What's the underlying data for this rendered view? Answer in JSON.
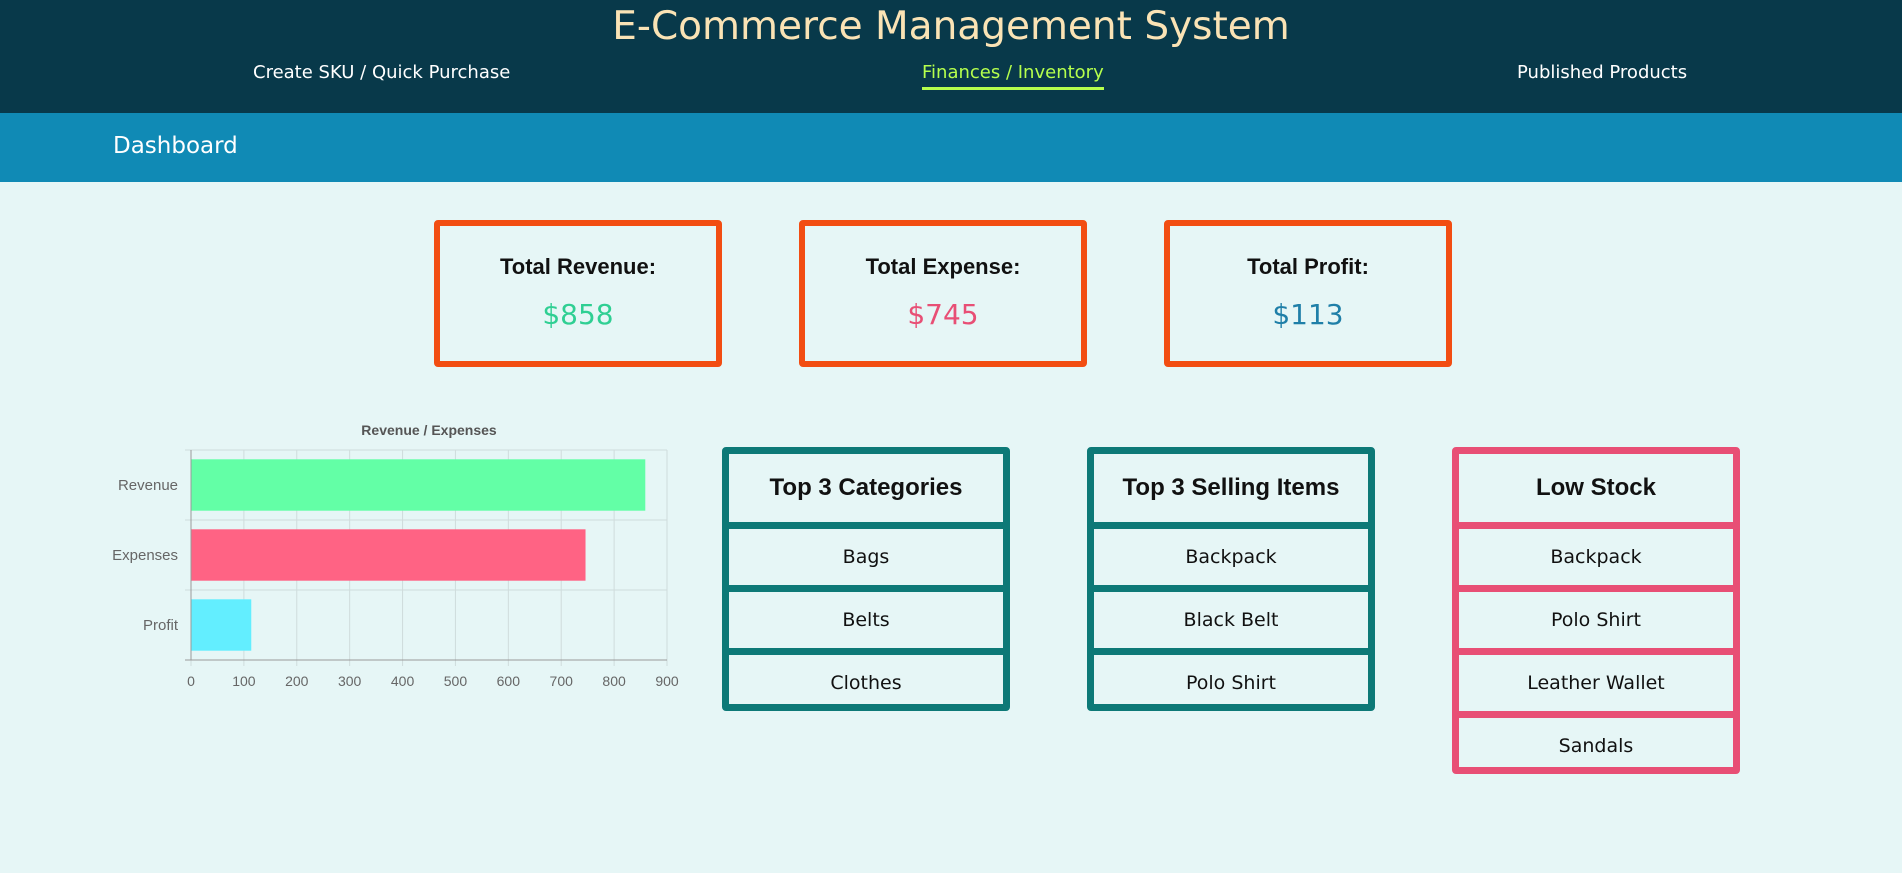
{
  "header": {
    "title": "E-Commerce Management System",
    "nav": [
      {
        "label": "Create SKU / Quick Purchase"
      },
      {
        "label": "Finances / Inventory"
      },
      {
        "label": "Published Products"
      }
    ]
  },
  "subheader": {
    "title": "Dashboard"
  },
  "summary": [
    {
      "label": "Total Revenue:",
      "value": "$858",
      "color": "#2fcf93"
    },
    {
      "label": "Total Expense:",
      "value": "$745",
      "color": "#e84f75"
    },
    {
      "label": "Total Profit:",
      "value": "$113",
      "color": "#1f7fa8"
    }
  ],
  "chart_data": {
    "type": "bar",
    "orientation": "horizontal",
    "title": "Revenue / Expenses",
    "categories": [
      "Revenue",
      "Expenses",
      "Profit"
    ],
    "values": [
      858,
      745,
      113
    ],
    "colors": [
      "#63ffa6",
      "#ff6384",
      "#63eeff"
    ],
    "xticks": [
      "0",
      "100",
      "200",
      "300",
      "400",
      "500",
      "600",
      "700",
      "800",
      "900"
    ],
    "xlim": [
      0,
      900
    ],
    "grid": true
  },
  "lists": {
    "categories": {
      "title": "Top 3 Categories",
      "items": [
        "Bags",
        "Belts",
        "Clothes"
      ]
    },
    "selling": {
      "title": "Top 3 Selling Items",
      "items": [
        "Backpack",
        "Black Belt",
        "Polo Shirt"
      ]
    },
    "low_stock": {
      "title": "Low Stock",
      "items": [
        "Backpack",
        "Polo Shirt",
        "Leather Wallet",
        "Sandals"
      ]
    }
  }
}
